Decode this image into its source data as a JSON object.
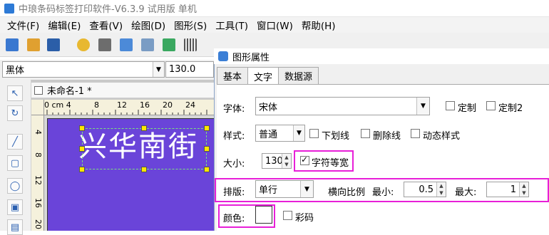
{
  "window": {
    "title": "中琅条码标签打印软件-V6.3.9 试用版 单机"
  },
  "menu": [
    "文件(F)",
    "编辑(E)",
    "查看(V)",
    "绘图(D)",
    "图形(S)",
    "工具(T)",
    "窗口(W)",
    "帮助(H)"
  ],
  "font_toolbar": {
    "font_family": "黑体",
    "font_size": "130.0"
  },
  "document": {
    "tab_title": "未命名-1 *",
    "label_text": "兴华南街",
    "label_bg": "#6a44d9",
    "hruler_ticks": [
      "0 cm 4",
      "8",
      "12",
      "16",
      "20",
      "24"
    ],
    "vruler_ticks": [
      "4",
      "8",
      "12",
      "16",
      "20"
    ]
  },
  "dialog": {
    "title": "图形属性",
    "tabs": [
      "基本",
      "文字",
      "数据源"
    ],
    "font_label": "字体:",
    "font_value": "宋体",
    "custom_label": "定制",
    "custom2_label": "定制2",
    "style_label": "样式:",
    "style_value": "普通",
    "underline_label": "下划线",
    "strike_label": "删除线",
    "dynamic_label": "动态样式",
    "size_label": "大小:",
    "size_value": "130",
    "equal_width_label": "字符等宽",
    "equal_width_checked": true,
    "layout_label": "排版:",
    "layout_value": "单行",
    "hscale_label": "横向比例",
    "min_label": "最小:",
    "min_value": "0.5",
    "max_label": "最大:",
    "max_value": "1",
    "color_label": "颜色:",
    "barcode_color_label": "彩码",
    "highlight_color": "#e81fd8"
  }
}
